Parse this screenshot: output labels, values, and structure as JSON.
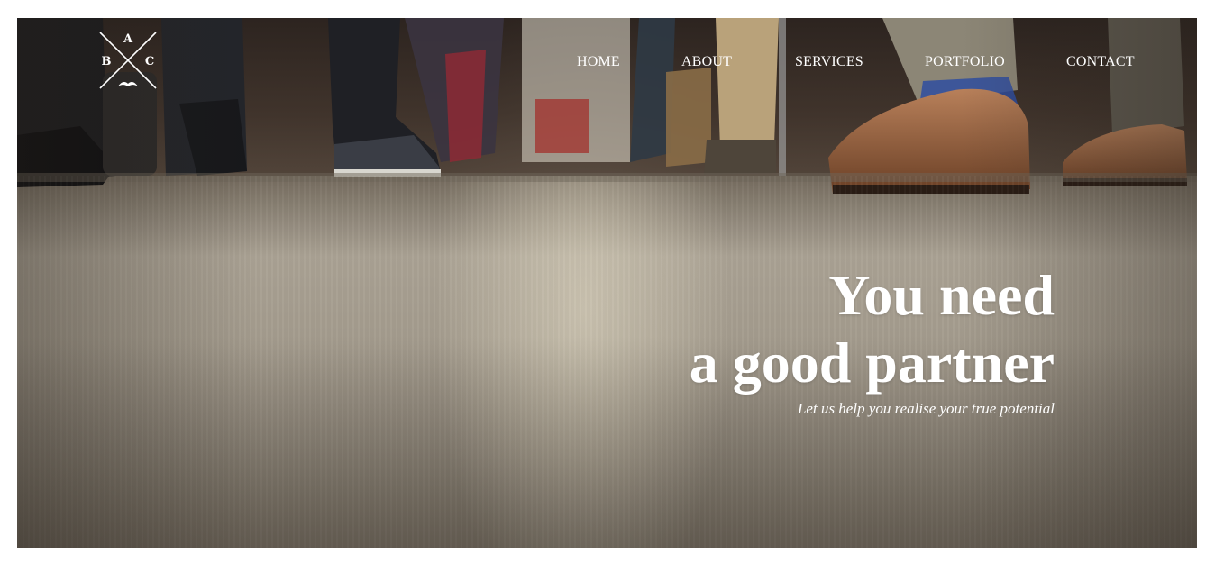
{
  "brand": {
    "logo_letters": [
      "A",
      "B",
      "C"
    ]
  },
  "nav": {
    "items": [
      {
        "label": "HOME"
      },
      {
        "label": "ABOUT"
      },
      {
        "label": "SERVICES"
      },
      {
        "label": "PORTFOLIO"
      },
      {
        "label": "CONTACT"
      }
    ]
  },
  "hero": {
    "headline_line1": "You need",
    "headline_line2": "a good partner",
    "tagline": "Let us help you realise your true potential",
    "background_image": "commuters-feet-on-train-floor"
  },
  "colors": {
    "text": "#ffffff",
    "page_background": "#ffffff",
    "hero_tone": "#a39b8d"
  }
}
